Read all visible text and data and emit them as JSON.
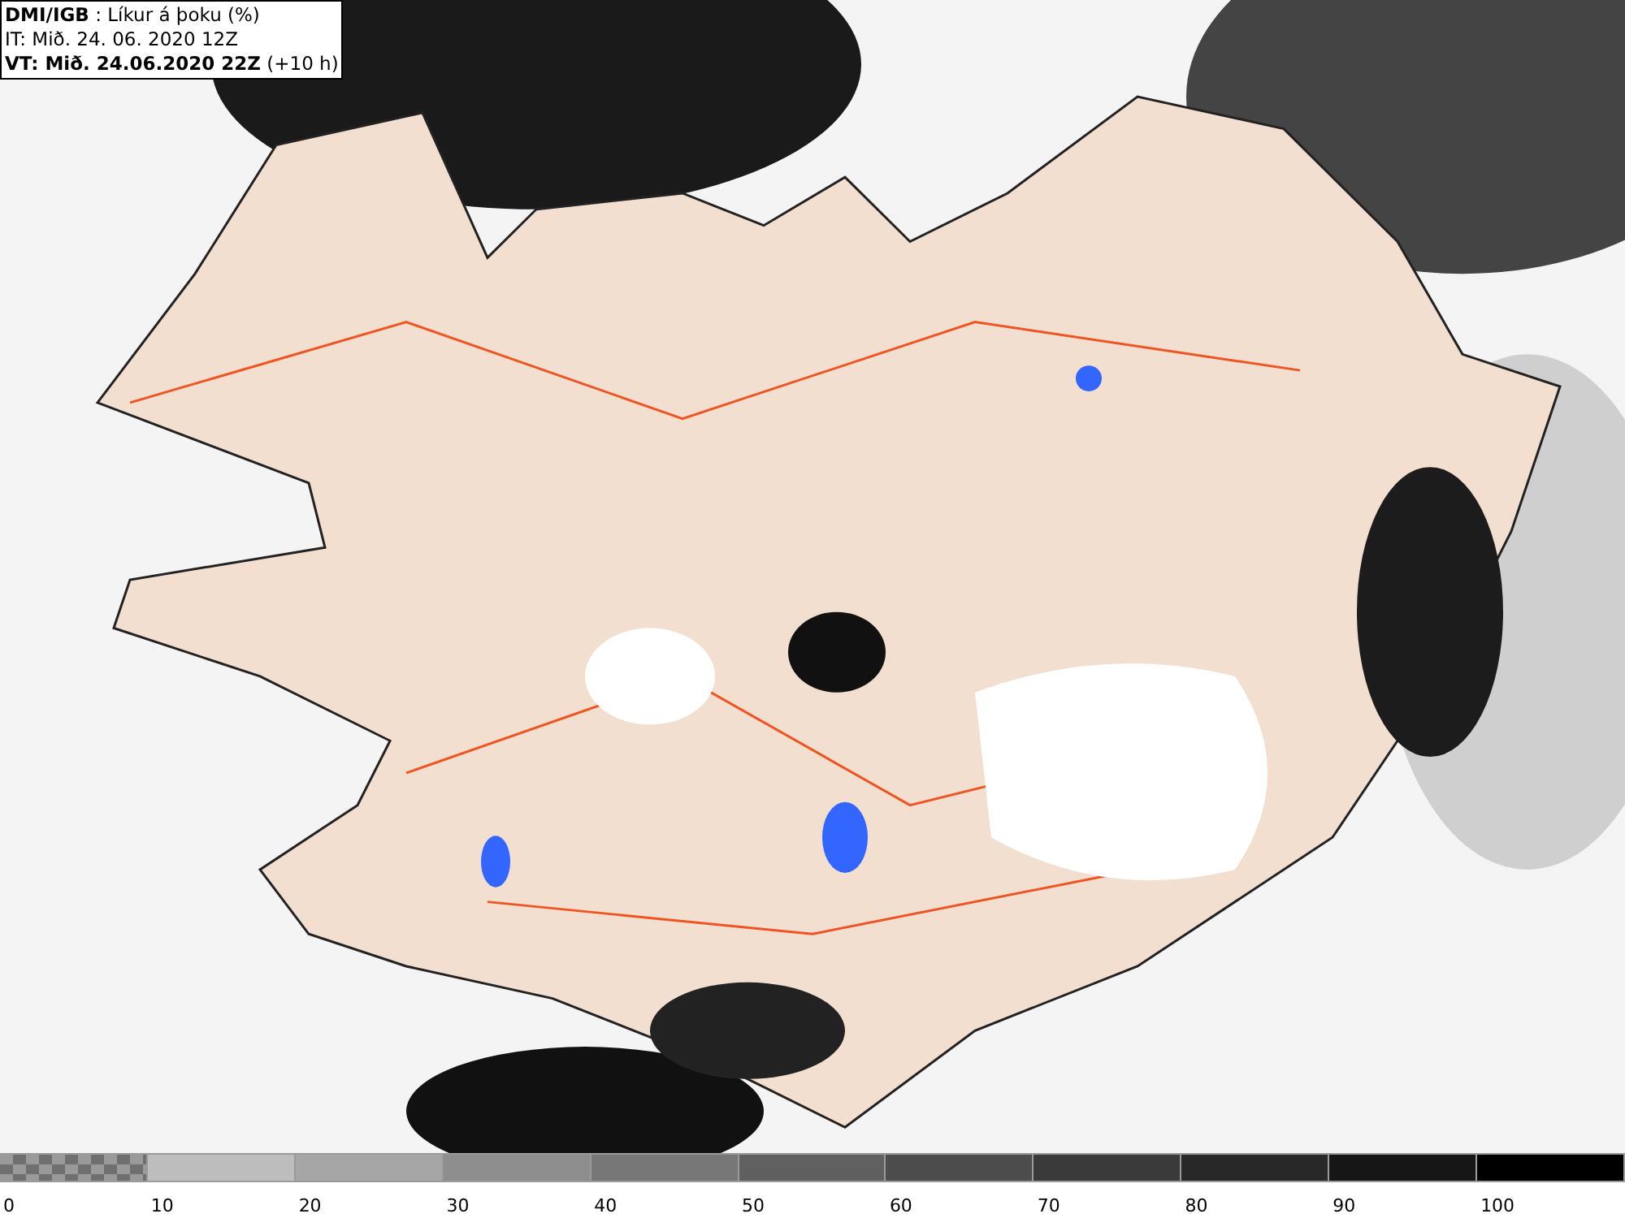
{
  "title_box": {
    "lines": [
      "**DMI/IGB** : Líkur á þoku (%)",
      "IT: Mið. 24. 06. 2020 12Z",
      "**VT: Mið. 24.06.2020 22Z** (+10 h)"
    ]
  },
  "legend": {
    "swatches": [
      {
        "kind": "pattern",
        "color": "#6f6f6f"
      },
      {
        "kind": "solid",
        "color": "#bdbdbd"
      },
      {
        "kind": "solid",
        "color": "#a6a6a6"
      },
      {
        "kind": "solid",
        "color": "#8e8e8e"
      },
      {
        "kind": "solid",
        "color": "#777777"
      },
      {
        "kind": "solid",
        "color": "#606060"
      },
      {
        "kind": "solid",
        "color": "#4c4c4c"
      },
      {
        "kind": "solid",
        "color": "#3a3a3a"
      },
      {
        "kind": "solid",
        "color": "#282828"
      },
      {
        "kind": "solid",
        "color": "#161616"
      },
      {
        "kind": "solid",
        "color": "#000000"
      }
    ],
    "labels": [
      "0",
      "10",
      "20",
      "30",
      "40",
      "50",
      "60",
      "70",
      "80",
      "90",
      "100"
    ]
  }
}
